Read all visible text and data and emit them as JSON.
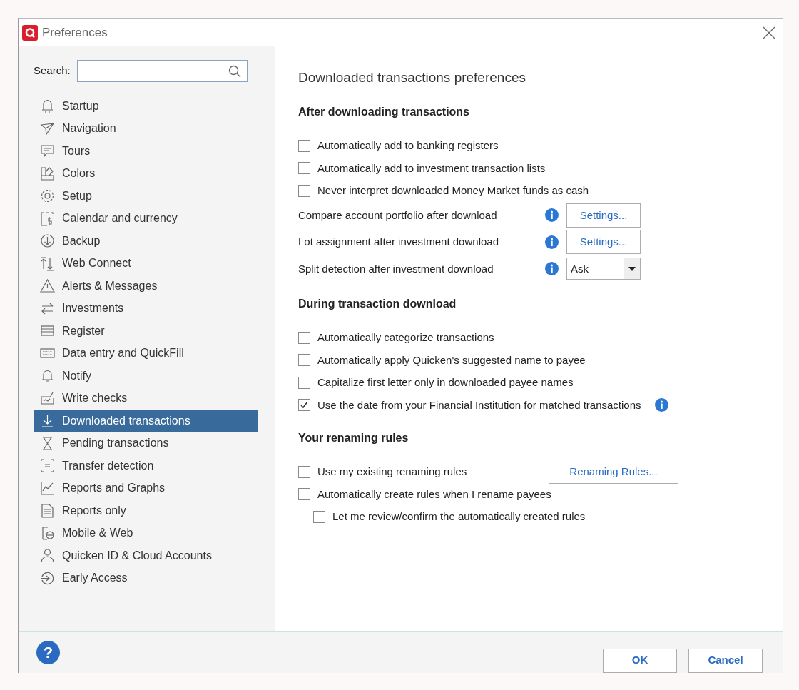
{
  "window": {
    "title": "Preferences"
  },
  "sidebar": {
    "search_label": "Search:",
    "items": [
      {
        "label": "Startup",
        "selected": false
      },
      {
        "label": "Navigation",
        "selected": false
      },
      {
        "label": "Tours",
        "selected": false
      },
      {
        "label": "Colors",
        "selected": false
      },
      {
        "label": "Setup",
        "selected": false
      },
      {
        "label": "Calendar and currency",
        "selected": false
      },
      {
        "label": "Backup",
        "selected": false
      },
      {
        "label": "Web Connect",
        "selected": false
      },
      {
        "label": "Alerts & Messages",
        "selected": false
      },
      {
        "label": "Investments",
        "selected": false
      },
      {
        "label": "Register",
        "selected": false
      },
      {
        "label": "Data entry and QuickFill",
        "selected": false
      },
      {
        "label": "Notify",
        "selected": false
      },
      {
        "label": "Write checks",
        "selected": false
      },
      {
        "label": "Downloaded transactions",
        "selected": true
      },
      {
        "label": "Pending transactions",
        "selected": false
      },
      {
        "label": "Transfer detection",
        "selected": false
      },
      {
        "label": "Reports and Graphs",
        "selected": false
      },
      {
        "label": "Reports only",
        "selected": false
      },
      {
        "label": "Mobile & Web",
        "selected": false
      },
      {
        "label": "Quicken ID & Cloud Accounts",
        "selected": false
      },
      {
        "label": "Early Access",
        "selected": false
      }
    ]
  },
  "content": {
    "heading": "Downloaded transactions preferences",
    "sections": [
      {
        "title": "After downloading transactions",
        "rows": [
          {
            "kind": "checkbox",
            "label": "Automatically add to banking registers",
            "checked": false,
            "info": false
          },
          {
            "kind": "checkbox",
            "label": "Automatically add to investment transaction lists",
            "checked": false,
            "info": false
          },
          {
            "kind": "checkbox",
            "label": "Never interpret downloaded Money Market funds as cash",
            "checked": false,
            "info": false
          },
          {
            "kind": "button",
            "label": "Compare account portfolio after download",
            "info": true,
            "button": "Settings..."
          },
          {
            "kind": "button",
            "label": "Lot assignment after investment download",
            "info": true,
            "button": "Settings..."
          },
          {
            "kind": "select",
            "label": "Split detection after investment download",
            "info": true,
            "value": "Ask"
          }
        ]
      },
      {
        "title": "During transaction download",
        "rows": [
          {
            "kind": "checkbox",
            "label": "Automatically categorize transactions",
            "checked": false,
            "info": false
          },
          {
            "kind": "checkbox",
            "label": "Automatically apply Quicken's suggested name to payee",
            "checked": false,
            "info": false
          },
          {
            "kind": "checkbox",
            "label": "Capitalize first letter only in downloaded payee names",
            "checked": false,
            "info": false
          },
          {
            "kind": "checkbox",
            "label": "Use the date from your Financial Institution for matched transactions",
            "checked": true,
            "info": true
          }
        ]
      },
      {
        "title": "Your renaming rules",
        "rows": [
          {
            "kind": "checkbox",
            "label": "Use my existing renaming rules",
            "checked": false,
            "info": false,
            "button": "Renaming Rules..."
          },
          {
            "kind": "checkbox",
            "label": "Automatically create rules when I rename payees",
            "checked": false,
            "info": false,
            "children": [
              {
                "kind": "checkbox",
                "label": "Let me review/confirm the automatically created rules",
                "checked": false,
                "info": false
              }
            ]
          }
        ]
      }
    ]
  },
  "footer": {
    "help": "?",
    "buttons": [
      "OK",
      "Cancel"
    ]
  }
}
